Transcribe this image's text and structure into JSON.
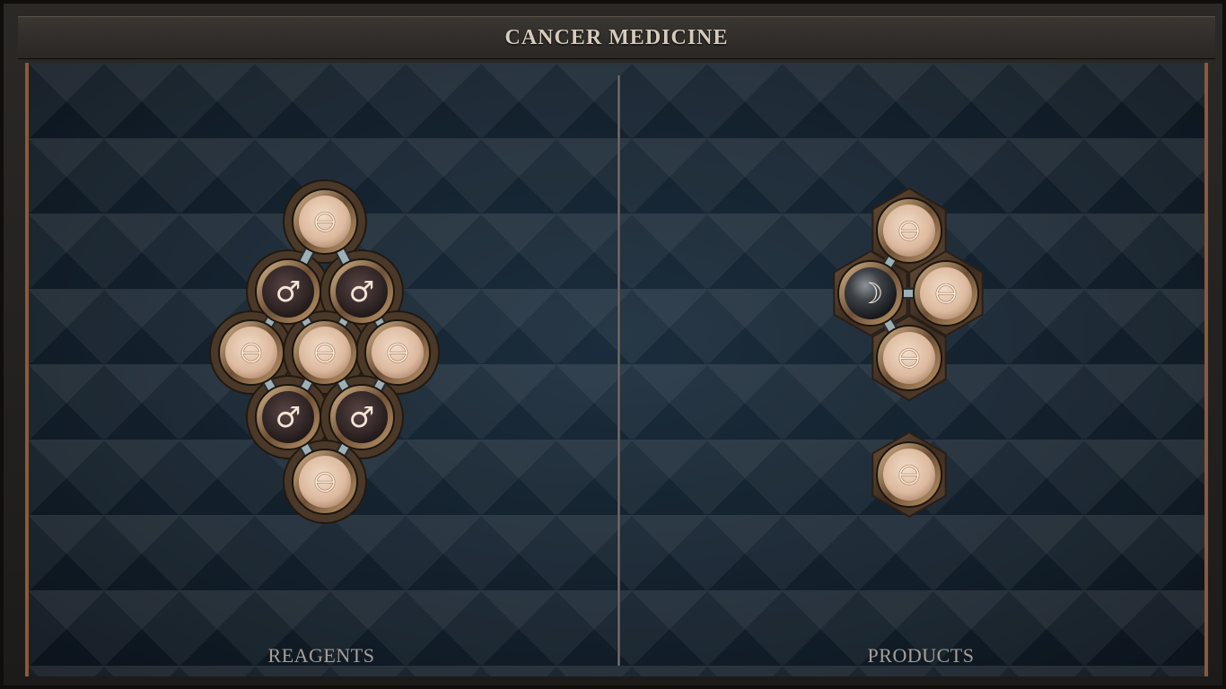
{
  "title": "CANCER MEDICINE",
  "panels": {
    "reagents_label": "REAGENTS",
    "products_label": "PRODUCTS"
  },
  "colors": {
    "board": "#13202c",
    "frame": "#2b2826",
    "light_atom": "#e2c5ac",
    "dark_atom": "#3a2c2c",
    "bond": "#9fb0b4",
    "accent_border": "#8a5a3a"
  },
  "elements": {
    "salt": {
      "symbol": "🜔",
      "icon": "salt-symbol"
    },
    "iron": {
      "symbol": "♂",
      "icon": "iron-symbol"
    },
    "silver": {
      "symbol": "☽",
      "icon": "silver-symbol"
    }
  },
  "reagent_molecule": {
    "atoms": [
      "salt",
      "iron",
      "iron",
      "salt",
      "salt",
      "salt",
      "iron",
      "iron",
      "salt"
    ]
  },
  "product_molecules": [
    {
      "atoms": [
        "silver",
        "salt",
        "salt",
        "salt"
      ]
    },
    {
      "atoms": [
        "salt"
      ]
    }
  ]
}
